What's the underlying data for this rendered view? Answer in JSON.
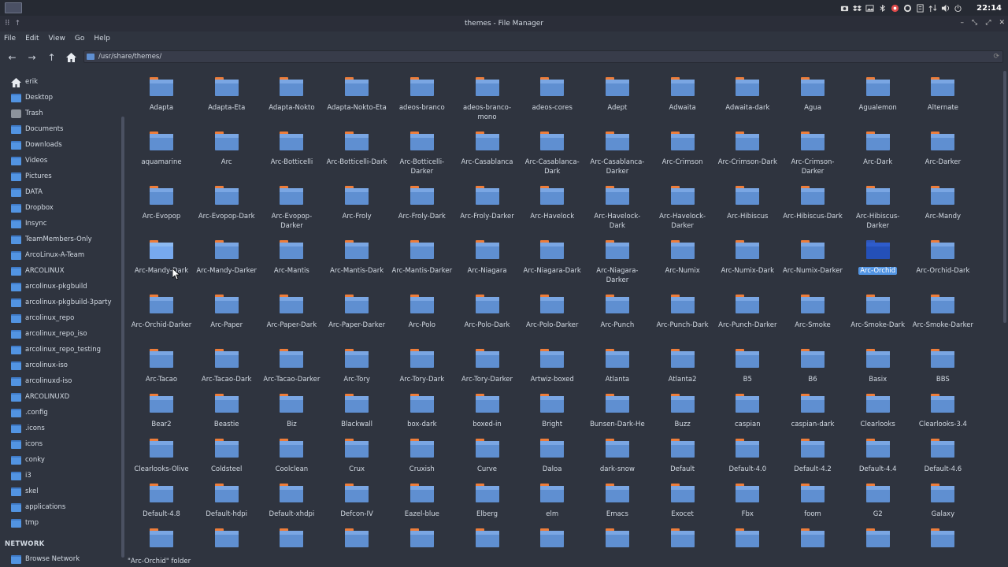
{
  "topbar": {
    "clock": "22:14"
  },
  "window": {
    "title": "themes - File Manager"
  },
  "menu": {
    "items": [
      "File",
      "Edit",
      "View",
      "Go",
      "Help"
    ]
  },
  "toolbar": {
    "path": "/usr/share/themes/"
  },
  "sidebar": {
    "places": [
      "erik",
      "Desktop",
      "Trash",
      "Documents",
      "Downloads",
      "Videos",
      "Pictures",
      "DATA",
      "Dropbox",
      "Insync",
      "TeamMembers-Only",
      "ArcoLinux-A-Team",
      "ARCOLINUX",
      "arcolinux-pkgbuild",
      "arcolinux-pkgbuild-3party",
      "arcolinux_repo",
      "arcolinux_repo_iso",
      "arcolinux_repo_testing",
      "arcolinux-iso",
      "arcolinuxd-iso",
      "ARCOLINUXD",
      ".config",
      ".icons",
      "icons",
      "conky",
      "i3",
      "skel",
      "applications",
      "tmp"
    ],
    "network_title": "NETWORK",
    "network_items": [
      "Browse Network"
    ]
  },
  "folders": [
    "Adapta",
    "Adapta-Eta",
    "Adapta-Nokto",
    "Adapta-Nokto-Eta",
    "adeos-branco",
    "adeos-branco-mono",
    "adeos-cores",
    "Adept",
    "Adwaita",
    "Adwaita-dark",
    "Agua",
    "Agualemon",
    "Alternate",
    "aquamarine",
    "Arc",
    "Arc-Botticelli",
    "Arc-Botticelli-Dark",
    "Arc-Botticelli-Darker",
    "Arc-Casablanca",
    "Arc-Casablanca-Dark",
    "Arc-Casablanca-Darker",
    "Arc-Crimson",
    "Arc-Crimson-Dark",
    "Arc-Crimson-Darker",
    "Arc-Dark",
    "Arc-Darker",
    "Arc-Evopop",
    "Arc-Evopop-Dark",
    "Arc-Evopop-Darker",
    "Arc-Froly",
    "Arc-Froly-Dark",
    "Arc-Froly-Darker",
    "Arc-Havelock",
    "Arc-Havelock-Dark",
    "Arc-Havelock-Darker",
    "Arc-Hibiscus",
    "Arc-Hibiscus-Dark",
    "Arc-Hibiscus-Darker",
    "Arc-Mandy",
    "Arc-Mandy-Dark",
    "Arc-Mandy-Darker",
    "Arc-Mantis",
    "Arc-Mantis-Dark",
    "Arc-Mantis-Darker",
    "Arc-Niagara",
    "Arc-Niagara-Dark",
    "Arc-Niagara-Darker",
    "Arc-Numix",
    "Arc-Numix-Dark",
    "Arc-Numix-Darker",
    "Arc-Orchid",
    "Arc-Orchid-Dark",
    "Arc-Orchid-Darker",
    "Arc-Paper",
    "Arc-Paper-Dark",
    "Arc-Paper-Darker",
    "Arc-Polo",
    "Arc-Polo-Dark",
    "Arc-Polo-Darker",
    "Arc-Punch",
    "Arc-Punch-Dark",
    "Arc-Punch-Darker",
    "Arc-Smoke",
    "Arc-Smoke-Dark",
    "Arc-Smoke-Darker",
    "Arc-Tacao",
    "Arc-Tacao-Dark",
    "Arc-Tacao-Darker",
    "Arc-Tory",
    "Arc-Tory-Dark",
    "Arc-Tory-Darker",
    "Artwiz-boxed",
    "Atlanta",
    "Atlanta2",
    "B5",
    "B6",
    "Basix",
    "BBS",
    "Bear2",
    "Beastie",
    "Biz",
    "Blackwall",
    "box-dark",
    "boxed-in",
    "Bright",
    "Bunsen-Dark-He",
    "Buzz",
    "caspian",
    "caspian-dark",
    "Clearlooks",
    "Clearlooks-3.4",
    "Clearlooks-Olive",
    "Coldsteel",
    "Coolclean",
    "Crux",
    "Cruxish",
    "Curve",
    "Daloa",
    "dark-snow",
    "Default",
    "Default-4.0",
    "Default-4.2",
    "Default-4.4",
    "Default-4.6",
    "Default-4.8",
    "Default-hdpi",
    "Default-xhdpi",
    "Defcon-IV",
    "Eazel-blue",
    "Elberg",
    "elm",
    "Emacs",
    "Exocet",
    "Fbx",
    "foom",
    "G2",
    "Galaxy",
    "",
    "",
    "",
    "",
    "",
    "",
    "",
    "",
    "",
    "",
    "",
    "",
    ""
  ],
  "selected": "Arc-Orchid",
  "hovered": "Arc-Mandy-Dark",
  "status": {
    "text": "\"Arc-Orchid\" folder"
  },
  "colors": {
    "accent": "#5294e2",
    "folder": "#5f8fd1",
    "folder_tab": "#ee7d3a",
    "selected_folder": "#2450b8"
  }
}
